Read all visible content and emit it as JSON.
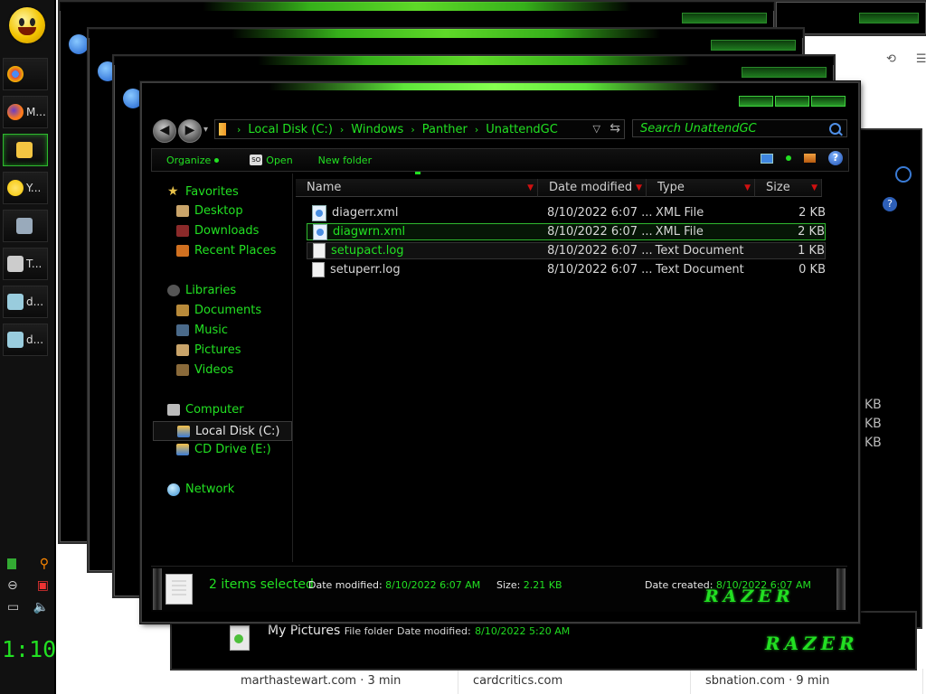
{
  "browser": {
    "tools": [
      "⟲",
      "☰"
    ],
    "close_glyph": "✕",
    "news": [
      "marthastewart.com · 3 min",
      "cardcritics.com",
      "sbnation.com · 9 min"
    ]
  },
  "taskbar": {
    "buttons": [
      {
        "label": "",
        "icon": "chrome-icon",
        "color": "#dd4b39"
      },
      {
        "label": "M...",
        "icon": "firefox-icon",
        "color": "#ff7b1b"
      },
      {
        "label": "",
        "icon": "folder-icon",
        "color": "#f4c542"
      },
      {
        "label": "Y...",
        "icon": "smiley-icon",
        "color": "#f3c400"
      },
      {
        "label": "",
        "icon": "monitor-icon",
        "color": "#9ab"
      },
      {
        "label": "T...",
        "icon": "computer-icon",
        "color": "#ccc"
      },
      {
        "label": "d...",
        "icon": "notepad-icon",
        "color": "#9cd"
      },
      {
        "label": "d...",
        "icon": "notepad-icon",
        "color": "#9cd"
      }
    ],
    "clock": "1:10"
  },
  "explorer": {
    "breadcrumbs": [
      "Local Disk (C:)",
      "Windows",
      "Panther",
      "UnattendGC"
    ],
    "search_placeholder": "Search UnattendGC",
    "toolbar": {
      "organize": "Organize",
      "open": "Open",
      "new_folder": "New folder"
    },
    "nav": {
      "favorites": "Favorites",
      "favorites_items": [
        "Desktop",
        "Downloads",
        "Recent Places"
      ],
      "libraries": "Libraries",
      "libraries_items": [
        "Documents",
        "Music",
        "Pictures",
        "Videos"
      ],
      "computer": "Computer",
      "computer_items": [
        "Local Disk (C:)",
        "CD Drive (E:)"
      ],
      "network": "Network"
    },
    "columns": [
      "Name",
      "Date modified",
      "Type",
      "Size"
    ],
    "files": [
      {
        "name": "diagerr.xml",
        "date": "8/10/2022 6:07 ...",
        "type": "XML File",
        "size": "2 KB",
        "icon": "xml-file-icon"
      },
      {
        "name": "diagwrn.xml",
        "date": "8/10/2022 6:07 ...",
        "type": "XML File",
        "size": "2 KB",
        "icon": "xml-file-icon"
      },
      {
        "name": "setupact.log",
        "date": "8/10/2022 6:07 ...",
        "type": "Text Document",
        "size": "1 KB",
        "icon": "text-file-icon"
      },
      {
        "name": "setuperr.log",
        "date": "8/10/2022 6:07 ...",
        "type": "Text Document",
        "size": "0 KB",
        "icon": "text-file-icon"
      }
    ],
    "details": {
      "summary": "2 items selected",
      "date_modified_label": "Date modified:",
      "date_modified": "8/10/2022 6:07 AM",
      "size_label": "Size:",
      "size": "2.21 KB",
      "date_created_label": "Date created:",
      "date_created": "8/10/2022 6:07 AM",
      "brand": "RAZER"
    }
  },
  "back_window": {
    "kb": [
      "KB",
      "KB",
      "KB"
    ]
  },
  "strip": {
    "name": "My Pictures",
    "kind": "File folder",
    "date_label": "Date modified:",
    "date": "8/10/2022 5:20 AM",
    "brand": "RAZER"
  },
  "colors": {
    "accent": "#22e022",
    "window_bg": "#000000",
    "sort_arrow": "#d01010"
  }
}
